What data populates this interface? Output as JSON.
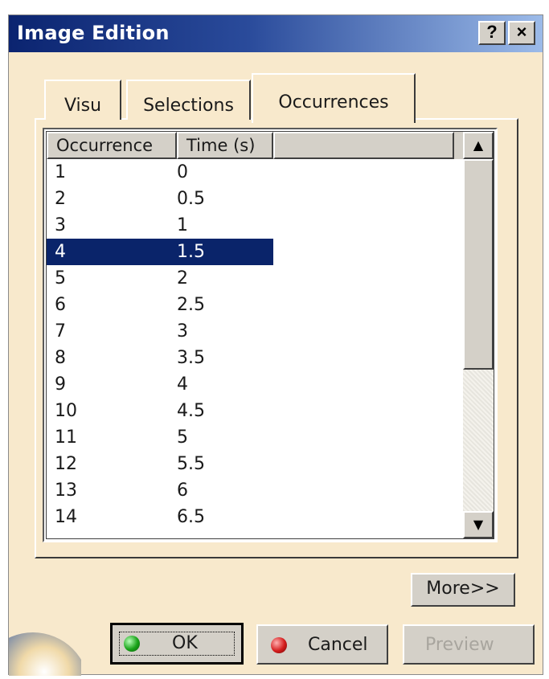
{
  "window": {
    "title": "Image Edition",
    "help_label": "?",
    "close_label": "×"
  },
  "tabs": [
    {
      "label": "Visu",
      "active": false
    },
    {
      "label": "Selections",
      "active": false
    },
    {
      "label": "Occurrences",
      "active": true
    }
  ],
  "table": {
    "columns": [
      "Occurrence",
      "Time (s)"
    ],
    "selected_row": 3,
    "rows": [
      {
        "occurrence": "1",
        "time": "0"
      },
      {
        "occurrence": "2",
        "time": "0.5"
      },
      {
        "occurrence": "3",
        "time": "1"
      },
      {
        "occurrence": "4",
        "time": "1.5"
      },
      {
        "occurrence": "5",
        "time": "2"
      },
      {
        "occurrence": "6",
        "time": "2.5"
      },
      {
        "occurrence": "7",
        "time": "3"
      },
      {
        "occurrence": "8",
        "time": "3.5"
      },
      {
        "occurrence": "9",
        "time": "4"
      },
      {
        "occurrence": "10",
        "time": "4.5"
      },
      {
        "occurrence": "11",
        "time": "5"
      },
      {
        "occurrence": "12",
        "time": "5.5"
      },
      {
        "occurrence": "13",
        "time": "6"
      },
      {
        "occurrence": "14",
        "time": "6.5"
      }
    ]
  },
  "buttons": {
    "more": "More>>",
    "ok": "OK",
    "cancel": "Cancel",
    "preview": "Preview"
  },
  "icons": {
    "scroll_up": "▲",
    "scroll_down": "▼",
    "ok_icon": "green-ball-icon",
    "cancel_icon": "red-ball-icon"
  },
  "colors": {
    "titlebar_start": "#0b2470",
    "titlebar_end": "#9cbbe9",
    "selection": "#0a246a",
    "dialog_bg": "#f8e9cc"
  }
}
